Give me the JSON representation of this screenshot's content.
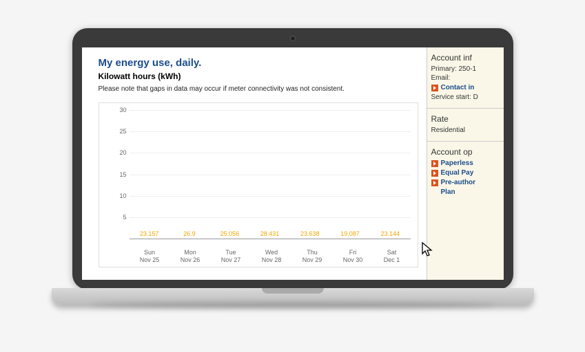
{
  "title": "My energy use, daily.",
  "subtitle": "Kilowatt hours (kWh)",
  "note": "Please note that gaps in data may occur if meter connectivity was not consistent.",
  "chart_data": {
    "type": "bar",
    "categories": [
      "Sun\nNov 25",
      "Mon\nNov 26",
      "Tue\nNov 27",
      "Wed\nNov 28",
      "Thu\nNov 29",
      "Fri\nNov 30",
      "Sat\nDec 1"
    ],
    "values": [
      23.157,
      26.9,
      25.056,
      28.431,
      23.638,
      19.087,
      23.144
    ],
    "title": "My energy use, daily.",
    "xlabel": "",
    "ylabel": "",
    "ylim": [
      0,
      30
    ],
    "yticks": [
      5,
      10,
      15,
      20,
      25,
      30
    ],
    "bar_color": "#f6c613"
  },
  "sidebar": {
    "account_info_title": "Account inf",
    "primary": "Primary: 250-1",
    "email": "Email:",
    "contact_link": "Contact in",
    "service_start": "Service start: D",
    "rate_title": "Rate",
    "rate_value": "Residential",
    "options_title": "Account op",
    "opt1": "Paperless",
    "opt2": "Equal Pay",
    "opt3a": "Pre-author",
    "opt3b": "Plan"
  }
}
